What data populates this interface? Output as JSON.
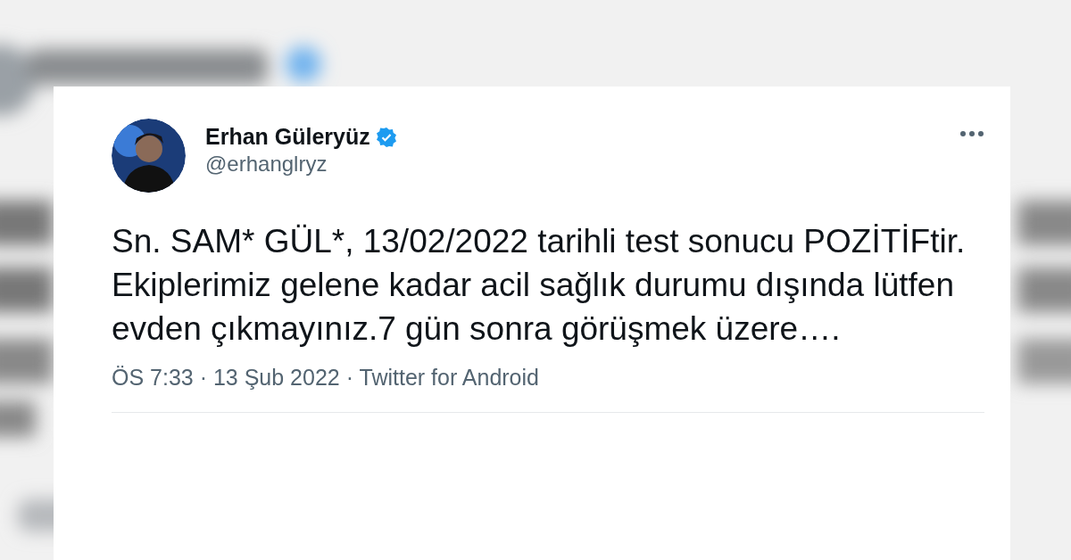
{
  "tweet": {
    "author": {
      "name": "Erhan Güleryüz",
      "verified": true,
      "handle": "@erhanglryz"
    },
    "text": "Sn. SAM* GÜL*, 13/02/2022 tarihli test sonucu POZİTİFtir. Ekiplerimiz gelene kadar acil sağlık durumu dışında lütfen evden çıkmayınız.7 gün sonra görüşmek üzere….",
    "meta": "ÖS 7:33 · 13 Şub 2022 · Twitter for Android"
  }
}
